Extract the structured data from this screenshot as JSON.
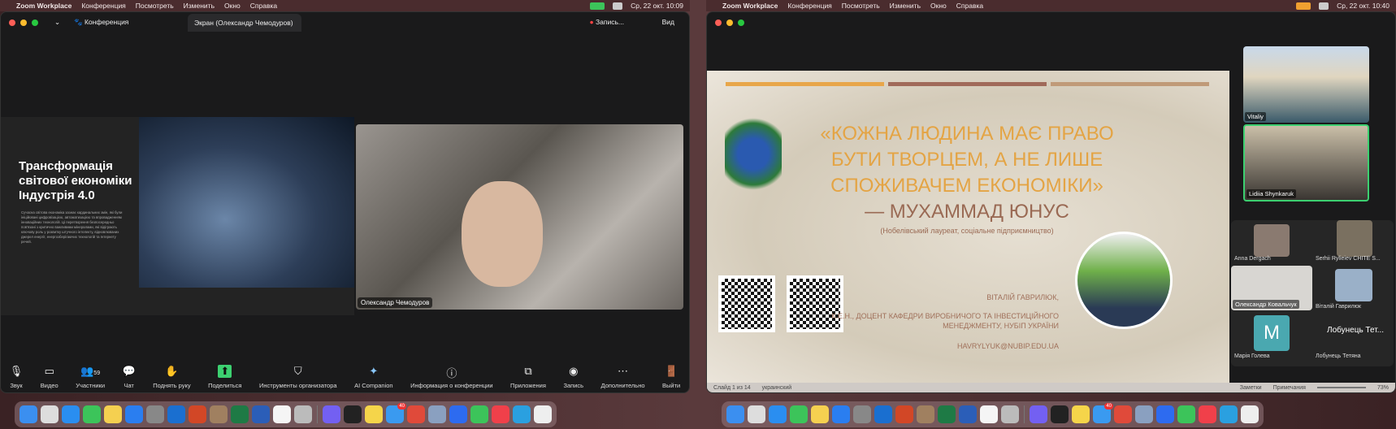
{
  "left": {
    "menubar": {
      "app": "Zoom Workplace",
      "items": [
        "Конференция",
        "Посмотреть",
        "Изменить",
        "Окно",
        "Справка"
      ],
      "clock": "Ср, 22 окт. 10:09"
    },
    "title": {
      "meeting": "Конференция",
      "tab": "Экран (Олександр Чемодуров)",
      "record": "Запись...",
      "view": "Вид"
    },
    "slide": {
      "title": "Трансформація світової економіки Індустрія 4.0",
      "body": "Сучасна світова економіка зазнає кардинальних змін, які були ініційовані цифровізацією, автоматизацією та впровадженням інноваційних технологій. Ці перетворення безпосередньо пов'язані з критично важливими мінералами, які відіграють ключову роль у розвитку штучного інтелекту, відновлюваних джерел енергії, енергозберігаючих технологій та Інтернету речей."
    },
    "video": {
      "name": "Олександр Чемодуров"
    },
    "toolbar": [
      {
        "icon": "microphone-icon",
        "glyph": "🎙",
        "label": "Звук"
      },
      {
        "icon": "video-icon",
        "glyph": "▭",
        "label": "Видео"
      },
      {
        "icon": "participants-icon",
        "glyph": "👥",
        "label": "Участники",
        "count": "59"
      },
      {
        "icon": "chat-icon",
        "glyph": "💬",
        "label": "Чат"
      },
      {
        "icon": "hand-icon",
        "glyph": "✋",
        "label": "Поднять руку"
      },
      {
        "icon": "share-icon",
        "glyph": "⬆",
        "label": "Поделиться"
      },
      {
        "icon": "shield-icon",
        "glyph": "⛉",
        "label": "Инструменты организатора"
      },
      {
        "icon": "sparkle-icon",
        "glyph": "✦",
        "label": "AI Companion"
      },
      {
        "icon": "info-icon",
        "glyph": "ⓘ",
        "label": "Информация о конференции"
      },
      {
        "icon": "apps-icon",
        "glyph": "⧉",
        "label": "Приложения"
      },
      {
        "icon": "record-icon",
        "glyph": "◉",
        "label": "Запись"
      },
      {
        "icon": "more-icon",
        "glyph": "⋯",
        "label": "Дополнительно"
      },
      {
        "icon": "leave-icon",
        "glyph": "🚪",
        "label": "Выйти"
      }
    ]
  },
  "right": {
    "menubar": {
      "app": "Zoom Workplace",
      "items": [
        "Конференция",
        "Посмотреть",
        "Изменить",
        "Окно",
        "Справка"
      ],
      "clock": "Ср, 22 окт. 10:40"
    },
    "slide": {
      "quote": "«КОЖНА ЛЮДИНА МАЄ ПРАВО БУТИ ТВОРЦЕМ, А НЕ ЛИШЕ СПОЖИВАЧЕМ ЕКОНОМІКИ»",
      "author": "— МУХАММАД ЮНУС",
      "note": "(Нобелівський лауреат, соціальне підприємництво)",
      "name": "ВІТАЛІЙ ГАВРИЛЮК,",
      "position": "К.Е.Н., ДОЦЕНТ КАФЕДРИ ВИРОБНИЧОГО ТА ІНВЕСТИЦІЙНОГО МЕНЕДЖМЕНТУ, НУБІП УКРАЇНИ",
      "email": "HAVRYLYUK@NUBIP.EDU.UA",
      "bar_colors": [
        "#e8a64a",
        "#a06a5a",
        "#c09a78"
      ]
    },
    "participants": {
      "large": [
        "Vitaliy",
        "Lidiia Shynkaruk"
      ],
      "small": [
        "Anna Dergach",
        "Serhii Ryliеiev CHITE S...",
        "Олександр Ковальчук",
        "Віталій Гаврилюк",
        "Марія Голева",
        "Лобунець Тетяна"
      ],
      "avatar_letter": "M",
      "placeholder": "Лобунець Тет..."
    },
    "status": {
      "slide": "Слайд 1 из 14",
      "lang": "украинский",
      "notes": "Заметки",
      "comments": "Примечания",
      "zoom": "73%"
    }
  },
  "dock": [
    {
      "name": "finder",
      "color": "#3b8ff0"
    },
    {
      "name": "launchpad",
      "color": "#ddd"
    },
    {
      "name": "safari",
      "color": "#2a8ef0"
    },
    {
      "name": "facetime",
      "color": "#3cc45a"
    },
    {
      "name": "photos",
      "color": "#f5d050"
    },
    {
      "name": "app-store",
      "color": "#2a7ef0"
    },
    {
      "name": "settings",
      "color": "#888"
    },
    {
      "name": "outlook",
      "color": "#1a6fd0"
    },
    {
      "name": "powerpoint",
      "color": "#d24726"
    },
    {
      "name": "contacts",
      "color": "#a08060"
    },
    {
      "name": "excel",
      "color": "#1e7a45"
    },
    {
      "name": "word",
      "color": "#2b5eb8"
    },
    {
      "name": "freeform",
      "color": "#f5f5f5"
    },
    {
      "name": "iphone-mirroring",
      "color": "#bbb"
    },
    {
      "name": "viber",
      "color": "#7360f2"
    },
    {
      "name": "terminal",
      "color": "#222"
    },
    {
      "name": "notes",
      "color": "#f5d54a"
    },
    {
      "name": "mail",
      "color": "#3a9af0",
      "badge": "40"
    },
    {
      "name": "chrome",
      "color": "#e04a3a"
    },
    {
      "name": "preview",
      "color": "#8aa0c0"
    },
    {
      "name": "zoom",
      "color": "#2d6bf0"
    },
    {
      "name": "messages",
      "color": "#3cc45a"
    },
    {
      "name": "music",
      "color": "#f0404a"
    },
    {
      "name": "telegram",
      "color": "#2aa0e0"
    },
    {
      "name": "textedit",
      "color": "#eee"
    }
  ]
}
